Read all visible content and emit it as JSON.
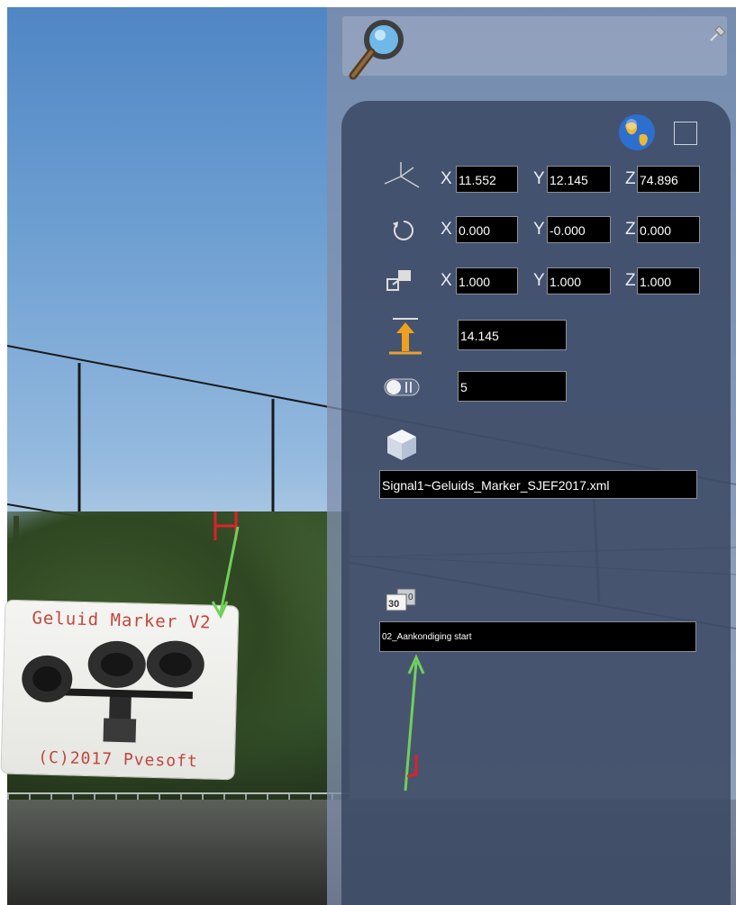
{
  "marker_sign": {
    "title": "Geluid Marker V2",
    "footer": "(C)2017 Pvesoft"
  },
  "panel": {
    "search_icon": "magnifier-icon",
    "pin_icon": "pin-icon",
    "world_icon": "globe-icon",
    "world_checkbox_checked": false,
    "position": {
      "x_label": "X",
      "x": "11.552",
      "y_label": "Y",
      "y": "12.145",
      "z_label": "Z",
      "z": "74.896"
    },
    "rotation": {
      "x_label": "X",
      "x": "0.000",
      "y_label": "Y",
      "y": "-0.000",
      "z_label": "Z",
      "z": "0.000"
    },
    "scale": {
      "x_label": "X",
      "x": "1.000",
      "y_label": "Y",
      "y": "1.000",
      "z_label": "Z",
      "z": "1.000"
    },
    "height_value": "14.145",
    "count_value": "5",
    "object_file": "Signal1~Geluids_Marker_SJEF2017.xml",
    "sound_name": "02_Aankondiging start"
  },
  "colors": {
    "panel_bg": "#808eaa",
    "field_bg": "#000000",
    "marker_red": "#c0473d",
    "arrow_green": "#6fd05a",
    "handle_red": "#e0202a"
  }
}
